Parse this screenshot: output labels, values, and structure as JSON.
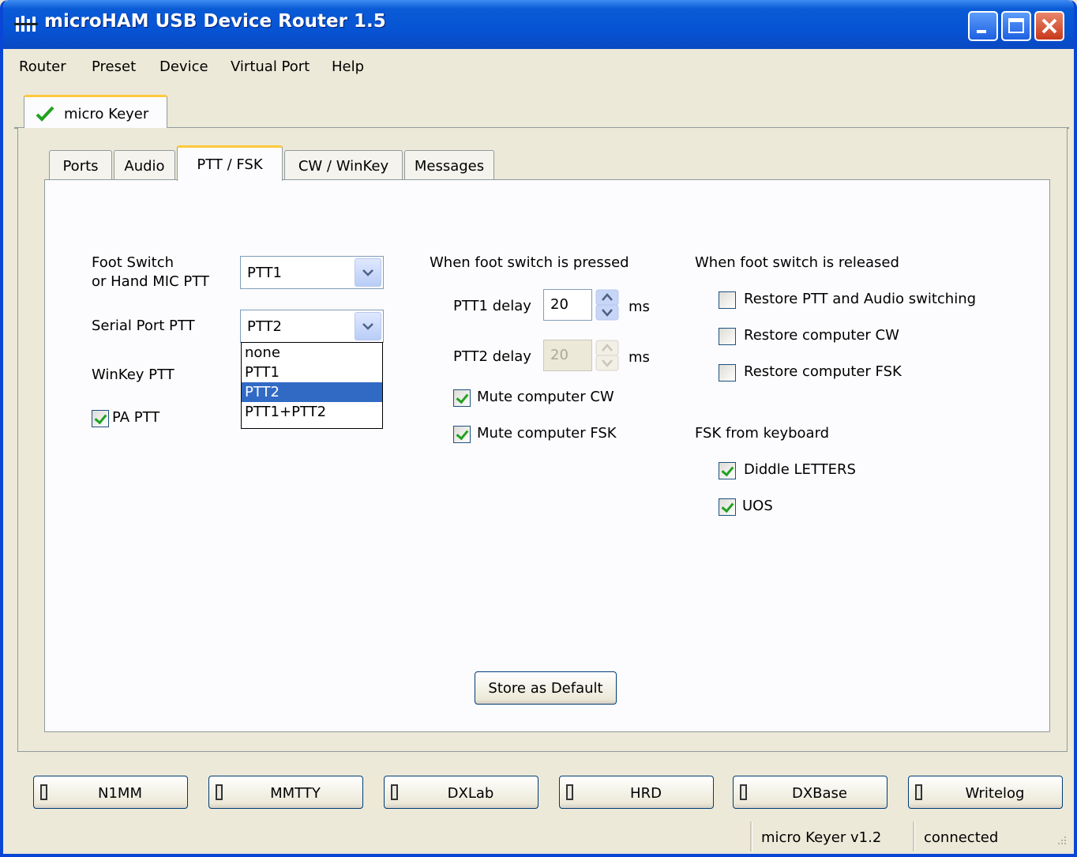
{
  "window": {
    "title": "microHAM USB Device Router 1.5",
    "controls": [
      "minimize",
      "maximize",
      "close"
    ]
  },
  "menu": [
    "Router",
    "Preset",
    "Device",
    "Virtual Port",
    "Help"
  ],
  "device_tab": {
    "label": "micro Keyer",
    "icon": "check-icon",
    "status_color": "#21a121"
  },
  "tabs": [
    "Ports",
    "Audio",
    "PTT / FSK",
    "CW / WinKey",
    "Messages"
  ],
  "active_tab": "PTT / FSK",
  "ptt_fsk": {
    "foot_switch_label_line1": "Foot Switch",
    "foot_switch_label_line2": "or Hand MIC PTT",
    "foot_switch_value": "PTT1",
    "serial_port_label": "Serial Port PTT",
    "serial_port_value": "PTT2",
    "serial_port_options": [
      "none",
      "PTT1",
      "PTT2",
      "PTT1+PTT2"
    ],
    "serial_port_highlighted": "PTT2",
    "winkey_label": "WinKey PTT",
    "pa_ptt_label": "PA PTT",
    "pa_ptt_checked": true,
    "pressed_heading": "When foot switch is pressed",
    "ptt1_delay_label": "PTT1 delay",
    "ptt1_delay_value": "20",
    "ptt2_delay_label": "PTT2 delay",
    "ptt2_delay_value": "20",
    "ms_unit": "ms",
    "mute_cw_label": "Mute computer CW",
    "mute_cw_checked": true,
    "mute_fsk_label": "Mute computer FSK",
    "mute_fsk_checked": true,
    "released_heading": "When foot switch is released",
    "restore_ptt_audio_label": "Restore PTT and Audio switching",
    "restore_ptt_audio_checked": false,
    "restore_cw_label": "Restore computer CW",
    "restore_cw_checked": false,
    "restore_fsk_label": "Restore computer FSK",
    "restore_fsk_checked": false,
    "fsk_keyboard_heading": "FSK from keyboard",
    "diddle_label": "Diddle LETTERS",
    "diddle_checked": true,
    "uos_label": "UOS",
    "uos_checked": true,
    "store_default_label": "Store as Default"
  },
  "bottom_buttons": [
    "N1MM",
    "MMTTY",
    "DXLab",
    "HRD",
    "DXBase",
    "Writelog"
  ],
  "status": {
    "device": "micro Keyer v1.2",
    "connection": "connected"
  },
  "colors": {
    "titlebar": "#0a5bd6",
    "selection": "#316ac5",
    "tab_accent": "#ffc83c",
    "check": "#21a121"
  }
}
